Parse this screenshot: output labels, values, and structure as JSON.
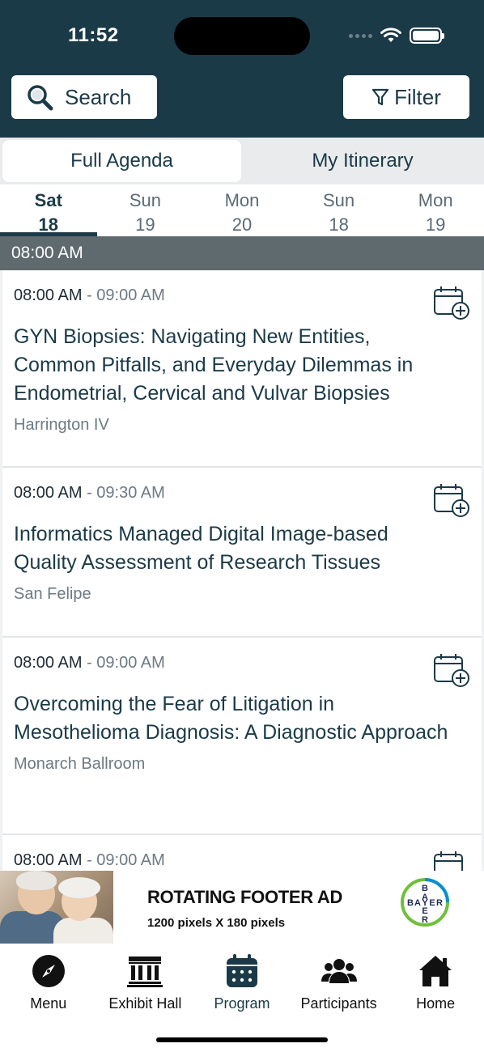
{
  "status_bar": {
    "time": "11:52"
  },
  "header": {
    "search_label": "Search",
    "filter_label": "Filter"
  },
  "segments": {
    "active": "Full Agenda",
    "other": "My Itinerary"
  },
  "days": [
    {
      "dow": "Sat",
      "num": "18",
      "selected": true
    },
    {
      "dow": "Sun",
      "num": "19",
      "selected": false
    },
    {
      "dow": "Mon",
      "num": "20",
      "selected": false
    },
    {
      "dow": "Sun",
      "num": "18",
      "selected": false
    },
    {
      "dow": "Mon",
      "num": "19",
      "selected": false
    }
  ],
  "time_group": "08:00 AM",
  "sessions": [
    {
      "start": "08:00 AM",
      "separator": " - ",
      "end": "09:00 AM",
      "title": "GYN Biopsies: Navigating New Entities, Common Pitfalls, and Everyday Dilemmas in Endometrial, Cervical and Vulvar Biopsies",
      "room": "Harrington IV"
    },
    {
      "start": "08:00 AM",
      "separator": " - ",
      "end": "09:30 AM",
      "title": "Informatics Managed Digital Image-based Quality Assessment of Research Tissues",
      "room": "San Felipe"
    },
    {
      "start": "08:00 AM",
      "separator": " - ",
      "end": "09:00 AM",
      "title": "Overcoming the Fear of Litigation in Mesothelioma Diagnosis: A Diagnostic Approach",
      "room": "Monarch Ballroom"
    },
    {
      "start": "08:00 AM",
      "separator": " - ",
      "end": "09:00 AM",
      "title": "",
      "room": ""
    }
  ],
  "ad": {
    "title": "ROTATING FOOTER AD",
    "subtitle": "1200 pixels X 180 pixels",
    "brand_letters": [
      "B",
      "A",
      "Y",
      "E",
      "R"
    ]
  },
  "tabs": [
    {
      "label": "Menu",
      "icon": "compass-icon"
    },
    {
      "label": "Exhibit Hall",
      "icon": "building-icon"
    },
    {
      "label": "Program",
      "icon": "calendar-icon",
      "active": true
    },
    {
      "label": "Participants",
      "icon": "people-icon"
    },
    {
      "label": "Home",
      "icon": "home-icon"
    }
  ],
  "colors": {
    "header_bg": "#1b3a47",
    "accent": "#1b3a47",
    "time_bar": "#5f6a6f"
  }
}
